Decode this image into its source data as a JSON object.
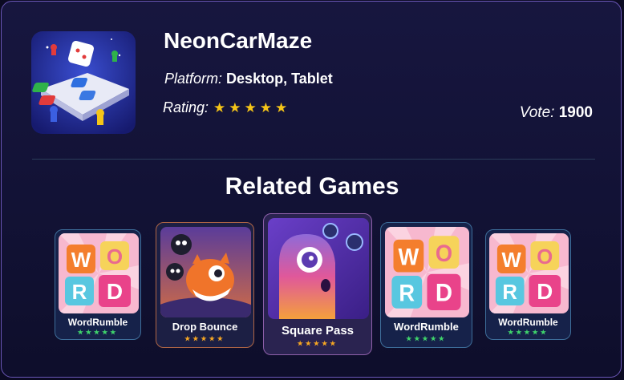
{
  "game": {
    "title": "NeonCarMaze",
    "platform_label": "Platform:",
    "platform_value": "Desktop, Tablet",
    "rating_label": "Rating:",
    "rating_stars": "★★★★★",
    "vote_label": "Vote:",
    "vote_value": "1900"
  },
  "related": {
    "heading": "Related Games",
    "items": [
      {
        "name": "WordRumble",
        "stars": "★★★★★",
        "star_color": "#3fd46b"
      },
      {
        "name": "Drop Bounce",
        "stars": "★★★★★",
        "star_color": "#f5a623"
      },
      {
        "name": "Square Pass",
        "stars": "★★★★★",
        "star_color": "#f5a623"
      },
      {
        "name": "WordRumble",
        "stars": "★★★★★",
        "star_color": "#3fd46b"
      },
      {
        "name": "WordRumble",
        "stars": "★★★★★",
        "star_color": "#3fd46b"
      }
    ]
  },
  "colors": {
    "star": "#f5c518",
    "border": "#6b57b8"
  }
}
